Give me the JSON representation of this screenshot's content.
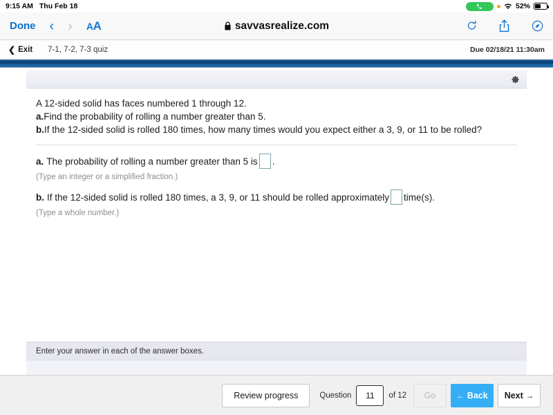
{
  "status_bar": {
    "time": "9:15 AM",
    "date": "Thu Feb 18",
    "call_icon": "phone-icon",
    "recording_dot": "orange-dot-indicator",
    "wifi_icon": "wifi-icon",
    "battery_percent": "52%",
    "battery_icon": "battery-icon"
  },
  "browser": {
    "done_label": "Done",
    "back_icon": "chevron-left-icon",
    "forward_icon": "chevron-right-icon",
    "text_size_label": "AA",
    "lock_icon": "lock-icon",
    "url": "savvasrealize.com",
    "reload_icon": "reload-icon",
    "share_icon": "share-icon",
    "tabs_icon": "compass-icon"
  },
  "app_header": {
    "exit_chevron": "chevron-left-icon",
    "exit_label": "Exit",
    "quiz_title": "7-1, 7-2, 7-3 quiz",
    "due_label": "Due 02/18/21 11:30am"
  },
  "toolbar": {
    "settings_icon": "gear-icon"
  },
  "question": {
    "stem": "A 12-sided solid has faces numbered 1 through 12.",
    "part_a_label": "a.",
    "part_a_prompt": "Find the probability of rolling a number greater than 5.",
    "part_b_label": "b.",
    "part_b_prompt": "If the 12-sided solid is rolled 180 times, how many times would you expect either a 3, 9, or 11 to be rolled?"
  },
  "answers": {
    "a": {
      "label": "a.",
      "text_before": "The probability of rolling a number greater than 5 is",
      "value": "",
      "text_after": ".",
      "hint": "(Type an integer or a simplified fraction.)"
    },
    "b": {
      "label": "b.",
      "text_before": "If the 12-sided solid is rolled 180 times, a 3, 9, or 11 should be rolled approximately",
      "value": "",
      "text_after": "time(s).",
      "hint": "(Type a whole number.)"
    }
  },
  "footer_message": {
    "text": "Enter your answer in each of the answer boxes."
  },
  "bottom_nav": {
    "review_label": "Review progress",
    "question_label": "Question",
    "question_number": "11",
    "of_label": "of 12",
    "go_label": "Go",
    "back_label": "Back",
    "back_icon": "arrow-left-icon",
    "next_label": "Next",
    "next_icon": "arrow-right-icon"
  },
  "colors": {
    "safari_blue": "#1374d4",
    "progress_blue": "#0a3f72",
    "back_button_blue": "#35aef5",
    "answer_box_border": "#79a3a8",
    "battery_green": "#33c759"
  }
}
